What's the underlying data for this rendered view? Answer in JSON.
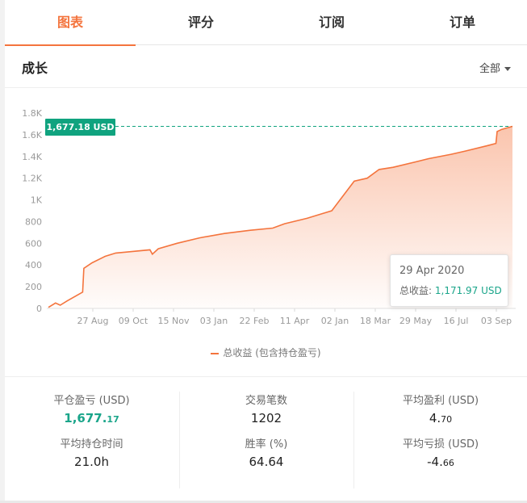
{
  "tabs": [
    {
      "label": "图表",
      "active": true
    },
    {
      "label": "评分",
      "active": false
    },
    {
      "label": "订阅",
      "active": false
    },
    {
      "label": "订单",
      "active": false
    }
  ],
  "section": {
    "title": "成长",
    "range_label": "全部"
  },
  "colors": {
    "accent": "#f4743d",
    "green": "#10a37f",
    "value_green": "#1aa58a"
  },
  "tooltip": {
    "date": "29 Apr 2020",
    "label": "总收益:",
    "value": "1,171.97 USD"
  },
  "current_tag": "1,677.18 USD",
  "legend": "总收益 (包含持仓盈亏)",
  "chart_data": {
    "type": "area",
    "x": [
      "2019-08-14",
      "2019-08-20",
      "2019-08-24",
      "2019-08-30",
      "2019-09-07",
      "2019-09-12",
      "2019-09-13",
      "2019-09-20",
      "2019-10-01",
      "2019-10-10",
      "2019-10-20",
      "2019-11-08",
      "2019-11-10",
      "2019-11-15",
      "2019-12-01",
      "2019-12-20",
      "2020-01-10",
      "2020-02-01",
      "2020-02-20",
      "2020-03-01",
      "2020-03-20",
      "2020-04-01",
      "2020-04-10",
      "2020-04-29",
      "2020-05-10",
      "2020-05-20",
      "2020-06-01",
      "2020-06-20",
      "2020-07-01",
      "2020-07-20",
      "2020-08-01",
      "2020-08-20",
      "2020-08-27",
      "2020-08-28",
      "2020-09-01",
      "2020-09-10"
    ],
    "values": [
      10,
      50,
      30,
      70,
      120,
      150,
      370,
      420,
      480,
      510,
      520,
      540,
      500,
      550,
      600,
      650,
      690,
      720,
      740,
      780,
      830,
      870,
      900,
      1172,
      1200,
      1280,
      1300,
      1350,
      1380,
      1420,
      1450,
      1500,
      1520,
      1630,
      1650,
      1677.18
    ],
    "series": [
      {
        "name": "总收益 (包含持仓盈亏)"
      }
    ],
    "y_ticks": [
      "0",
      "200",
      "400",
      "600",
      "800",
      "1K",
      "1.2K",
      "1.4K",
      "1.6K",
      "1.8K"
    ],
    "x_ticks": [
      "27 Aug",
      "09 Oct",
      "15 Nov",
      "03 Jan",
      "22 Feb",
      "11 Apr",
      "02 Jan",
      "18 Mar",
      "29 May",
      "16 Jul",
      "03 Sep"
    ],
    "ylim": [
      0,
      1800
    ],
    "grid": false,
    "legend": "bottom-center"
  },
  "stats": [
    [
      {
        "label": "平仓盈亏 (USD)",
        "int": "1,677.",
        "dec": "17",
        "green": true
      },
      {
        "label": "平均持仓时间",
        "int": "21.0h",
        "dec": "",
        "green": false
      }
    ],
    [
      {
        "label": "交易笔数",
        "int": "1202",
        "dec": "",
        "green": false
      },
      {
        "label": "胜率 (%)",
        "int": "64.64",
        "dec": "",
        "green": false
      }
    ],
    [
      {
        "label": "平均盈利 (USD)",
        "int": "4.",
        "dec": "70",
        "green": false
      },
      {
        "label": "平均亏损 (USD)",
        "int": "-4.",
        "dec": "66",
        "green": false
      }
    ]
  ]
}
